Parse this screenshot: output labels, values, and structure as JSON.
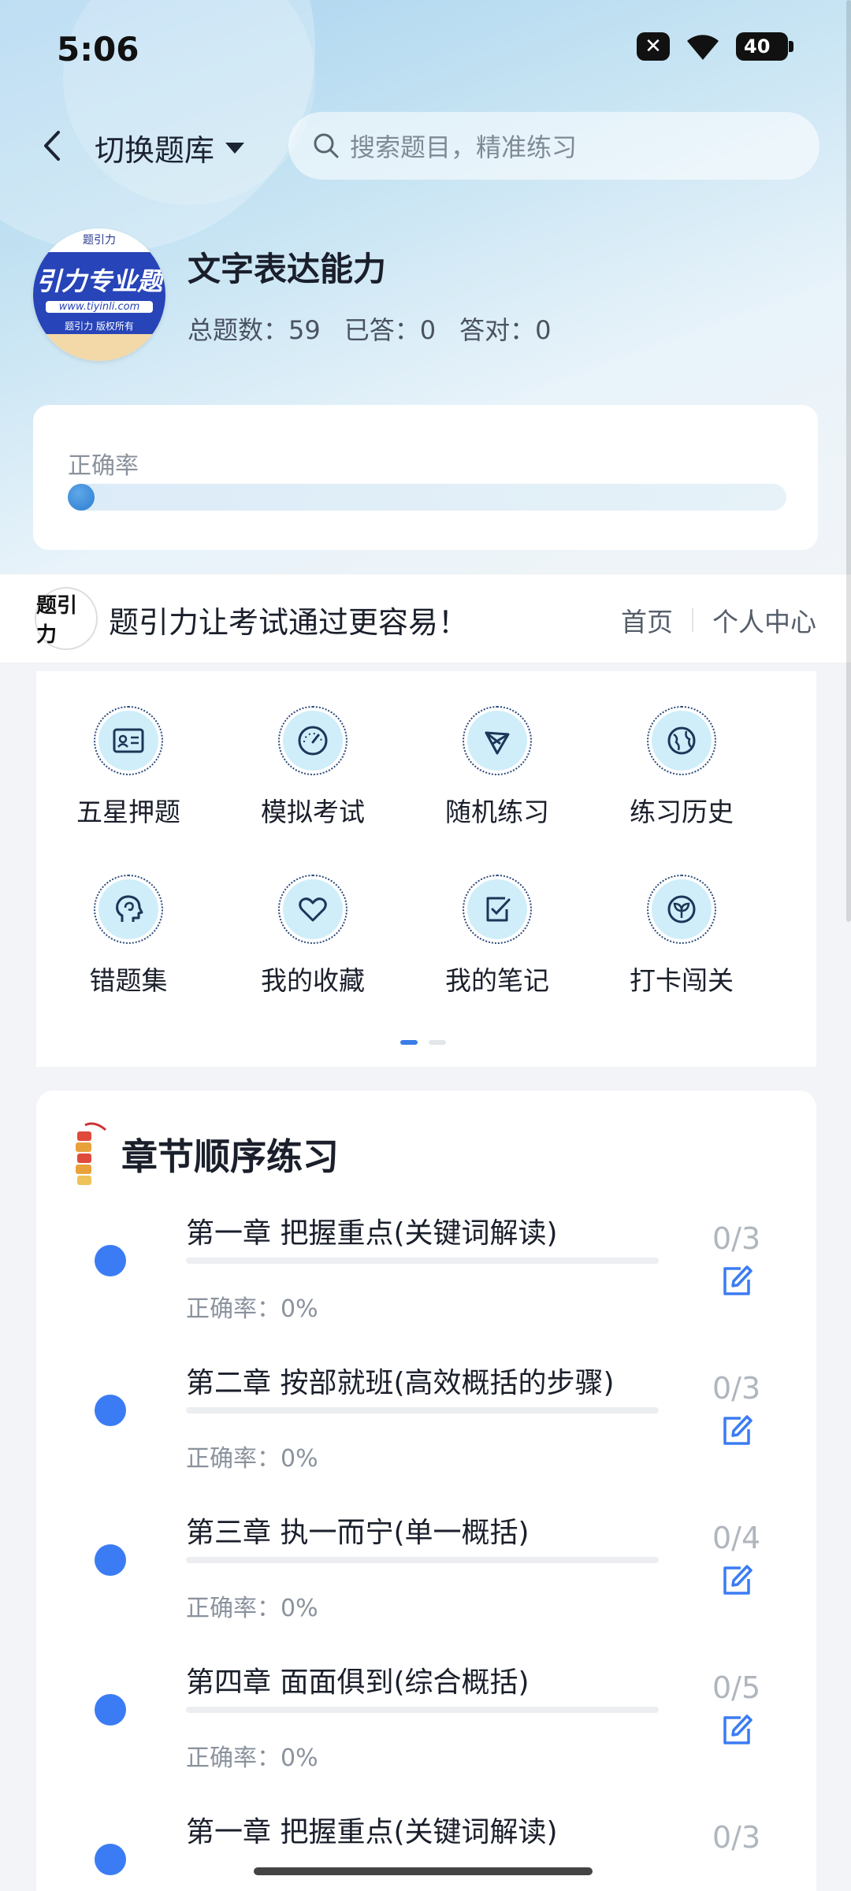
{
  "status": {
    "time": "5:06",
    "battery": "40"
  },
  "topbar": {
    "switch_label": "切换题库",
    "search_placeholder": "搜索题目，精准练习"
  },
  "subject": {
    "logo_text": "引力专业题",
    "logo_url": "www.tiyinli.com",
    "logo_copyright": "题引力 版权所有",
    "title": "文字表达能力",
    "stats": {
      "total": "总题数：59",
      "answered": "已答：0",
      "correct": "答对：0"
    }
  },
  "accuracy": {
    "label": "正确率",
    "value": 0
  },
  "brand": {
    "logo": "题引力",
    "slogan": "题引力让考试通过更容易！",
    "home": "首页",
    "personal": "个人中心"
  },
  "menu": [
    {
      "label": "五星押题",
      "icon": "id-card-icon"
    },
    {
      "label": "模拟考试",
      "icon": "speedometer-icon"
    },
    {
      "label": "随机练习",
      "icon": "network-icon"
    },
    {
      "label": "练习历史",
      "icon": "globe-icon"
    },
    {
      "label": "错题集",
      "icon": "brain-head-icon"
    },
    {
      "label": "我的收藏",
      "icon": "heart-icon"
    },
    {
      "label": "我的笔记",
      "icon": "note-check-icon"
    },
    {
      "label": "打卡闯关",
      "icon": "sprout-icon"
    }
  ],
  "chapters": {
    "title": "章节顺序练习",
    "items": [
      {
        "title": "第一章 把握重点(关键词解读)",
        "rate": "正确率：0%",
        "count": "0/3"
      },
      {
        "title": "第二章 按部就班(高效概括的步骤)",
        "rate": "正确率：0%",
        "count": "0/3"
      },
      {
        "title": "第三章 执一而宁(单一概括)",
        "rate": "正确率：0%",
        "count": "0/4"
      },
      {
        "title": "第四章 面面俱到(综合概括)",
        "rate": "正确率：0%",
        "count": "0/5"
      },
      {
        "title": "第一章 把握重点(关键词解读)",
        "rate": "",
        "count": "0/3"
      }
    ]
  },
  "colors": {
    "accent": "#3b7cf4",
    "icon_bg": "#cfeefa",
    "logo_blue": "#2744b8"
  }
}
